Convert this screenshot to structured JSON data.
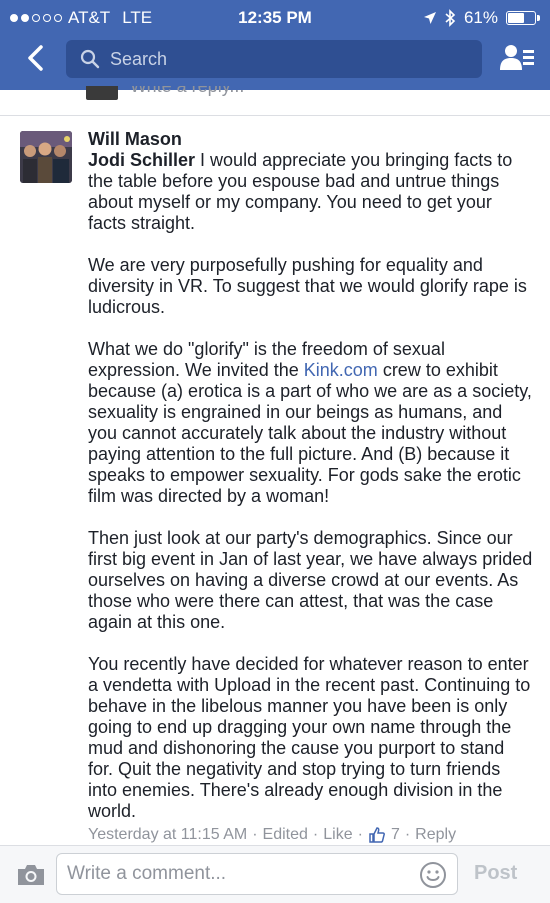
{
  "status_bar": {
    "carrier": "AT&T",
    "network": "LTE",
    "time": "12:35 PM",
    "battery": "61%",
    "battery_level": 0.61,
    "signal_bars": 2
  },
  "navbar": {
    "search_placeholder": "Search",
    "back_icon": "chevron-left-icon",
    "friends_icon": "friend-requests-icon"
  },
  "previous_reply": {
    "text": "Write a reply..."
  },
  "comment": {
    "author": "Will Mason",
    "mention": "Jodi Schiller",
    "para1_rest": " I would appreciate you bringing facts to the table before you espouse bad and untrue things about myself or my company. You need to get your facts straight.",
    "para2": "We are very purposefully pushing for equality and diversity in VR. To suggest that we would glorify rape is ludicrous.",
    "para3_before_link": "What we do \"glorify\" is the freedom of sexual expression. We invited the ",
    "para3_link": "Kink.com",
    "para3_after_link": " crew to exhibit because (a) erotica is a part of who we are as a society, sexuality is engrained in our beings as humans, and you cannot accurately talk about the industry without paying attention to the full picture. And (B) because it speaks to empower sexuality. For gods sake the erotic film was directed by a woman!",
    "para4": "Then just look at our party's demographics. Since our first big event in Jan of last year, we have always prided ourselves on having a diverse crowd at our events. As those who were there can attest, that was the case again at this one.",
    "para5": "You recently have decided for whatever reason to enter a vendetta with Upload in the recent past. Continuing to behave in the libelous manner you have been is only going to end up dragging your own name through the mud and dishonoring the cause you purport to stand for. Quit the negativity and stop trying to turn friends into enemies. There's already enough division in the world.",
    "meta": {
      "timestamp": "Yesterday at 11:15 AM",
      "edited": "Edited",
      "like": "Like",
      "like_count": "7",
      "reply": "Reply",
      "separator": "·"
    }
  },
  "composer": {
    "placeholder": "Write a comment...",
    "post_label": "Post",
    "camera_icon": "camera-icon",
    "emoji_icon": "smiley-icon"
  },
  "colors": {
    "header_blue": "#4267b2",
    "link_blue": "#4267b2",
    "meta_gray": "#90949c"
  }
}
